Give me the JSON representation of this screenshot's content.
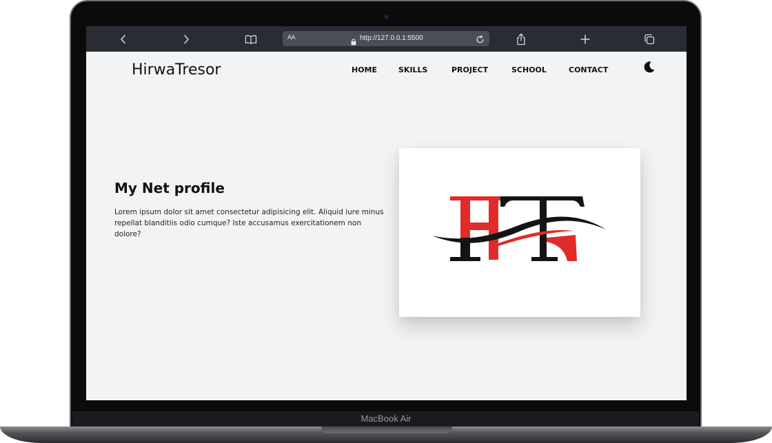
{
  "device": {
    "model_label": "MacBook Air"
  },
  "browser": {
    "back_icon": "chevron-left-icon",
    "forward_icon": "chevron-right-icon",
    "bookmarks_icon": "book-icon",
    "reader_label": "AA",
    "url": "http://127.0.0.1:5500",
    "share_icon": "share-icon",
    "new_tab_icon": "plus-icon",
    "tabs_icon": "tabs-icon"
  },
  "site": {
    "logo": "HirwaTresor",
    "nav": [
      "HOME",
      "SKILLS",
      "PROJECT",
      "SCHOOL",
      "CONTACT"
    ],
    "theme_icon": "moon-icon"
  },
  "hero": {
    "title": "My Net profile",
    "text": "Lorem ipsum dolor sit amet consectetur adipisicing elit. Aliquid iure minus repellat blanditiis odio cumque? Iste accusamus exercitationem non dolore?",
    "image_logo": "HT"
  },
  "colors": {
    "accent_red": "#e12b2b",
    "dark": "#141414",
    "toolbar": "#2a2c33",
    "page_bg": "#f2f3f5"
  }
}
